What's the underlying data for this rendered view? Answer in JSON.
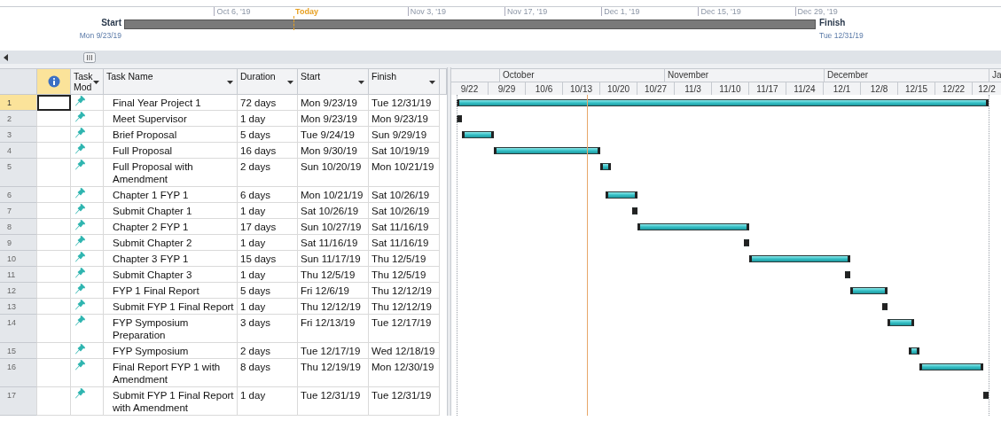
{
  "timeline": {
    "start_label": "Start",
    "start_date": "Mon 9/23/19",
    "finish_label": "Finish",
    "finish_date": "Tue 12/31/19",
    "ticks": [
      {
        "kind": "date",
        "label": "Oct 6, '19"
      },
      {
        "kind": "today",
        "label": "Today"
      },
      {
        "kind": "date",
        "label": "Nov 3, '19"
      },
      {
        "kind": "date",
        "label": "Nov 17, '19"
      },
      {
        "kind": "date",
        "label": "Dec 1, '19"
      },
      {
        "kind": "date",
        "label": "Dec 15, '19"
      },
      {
        "kind": "date",
        "label": "Dec 29, '19"
      }
    ]
  },
  "table": {
    "columns": [
      {
        "kind": "info",
        "selected": true
      },
      {
        "kind": "text",
        "label": "Task Mod",
        "selected": false
      },
      {
        "kind": "text",
        "label": "Task Name",
        "selected": false
      },
      {
        "kind": "text",
        "label": "Duration",
        "selected": false
      },
      {
        "kind": "text",
        "label": "Start",
        "selected": false
      },
      {
        "kind": "text",
        "label": "Finish",
        "selected": false
      }
    ],
    "rows": [
      {
        "id": "1",
        "name": "Final Year Project 1",
        "duration": "72 days",
        "start": "Mon 9/23/19",
        "finish": "Tue 12/31/19",
        "selected": true
      },
      {
        "id": "2",
        "name": "Meet Supervisor",
        "duration": "1 day",
        "start": "Mon 9/23/19",
        "finish": "Mon 9/23/19",
        "selected": false
      },
      {
        "id": "3",
        "name": "Brief Proposal",
        "duration": "5 days",
        "start": "Tue 9/24/19",
        "finish": "Sun 9/29/19",
        "selected": false
      },
      {
        "id": "4",
        "name": "Full Proposal",
        "duration": "16 days",
        "start": "Mon 9/30/19",
        "finish": "Sat 10/19/19",
        "selected": false
      },
      {
        "id": "5",
        "name": "Full Proposal with Amendment",
        "duration": "2 days",
        "start": "Sun 10/20/19",
        "finish": "Mon 10/21/19",
        "selected": false
      },
      {
        "id": "6",
        "name": "Chapter 1 FYP 1",
        "duration": "6 days",
        "start": "Mon 10/21/19",
        "finish": "Sat 10/26/19",
        "selected": false
      },
      {
        "id": "7",
        "name": "Submit Chapter 1",
        "duration": "1 day",
        "start": "Sat 10/26/19",
        "finish": "Sat 10/26/19",
        "selected": false
      },
      {
        "id": "8",
        "name": "Chapter 2 FYP 1",
        "duration": "17 days",
        "start": "Sun 10/27/19",
        "finish": "Sat 11/16/19",
        "selected": false
      },
      {
        "id": "9",
        "name": "Submit Chapter 2",
        "duration": "1 day",
        "start": "Sat 11/16/19",
        "finish": "Sat 11/16/19",
        "selected": false
      },
      {
        "id": "10",
        "name": "Chapter 3 FYP 1",
        "duration": "15 days",
        "start": "Sun 11/17/19",
        "finish": "Thu 12/5/19",
        "selected": false
      },
      {
        "id": "11",
        "name": "Submit Chapter 3",
        "duration": "1 day",
        "start": "Thu 12/5/19",
        "finish": "Thu 12/5/19",
        "selected": false
      },
      {
        "id": "12",
        "name": "FYP 1 Final Report",
        "duration": "5 days",
        "start": "Fri 12/6/19",
        "finish": "Thu 12/12/19",
        "selected": false
      },
      {
        "id": "13",
        "name": "Submit FYP 1 Final Report",
        "duration": "1 day",
        "start": "Thu 12/12/19",
        "finish": "Thu 12/12/19",
        "selected": false
      },
      {
        "id": "14",
        "name": "FYP Symposium Preparation",
        "duration": "3 days",
        "start": "Fri 12/13/19",
        "finish": "Tue 12/17/19",
        "selected": false
      },
      {
        "id": "15",
        "name": "FYP Symposium",
        "duration": "2 days",
        "start": "Tue 12/17/19",
        "finish": "Wed 12/18/19",
        "selected": false
      },
      {
        "id": "16",
        "name": "Final Report FYP 1 with Amendment",
        "duration": "8 days",
        "start": "Thu 12/19/19",
        "finish": "Mon 12/30/19",
        "selected": false
      },
      {
        "id": "17",
        "name": "Submit FYP 1 Final Report with Amendment",
        "duration": "1 day",
        "start": "Tue 12/31/19",
        "finish": "Tue 12/31/19",
        "selected": false
      }
    ]
  },
  "gantt": {
    "months": [
      "October",
      "November",
      "December",
      "Ja"
    ],
    "weeks": [
      "9/22",
      "9/29",
      "10/6",
      "10/13",
      "10/20",
      "10/27",
      "11/3",
      "11/10",
      "11/17",
      "11/24",
      "12/1",
      "12/8",
      "12/15",
      "12/22",
      "12/2"
    ]
  }
}
